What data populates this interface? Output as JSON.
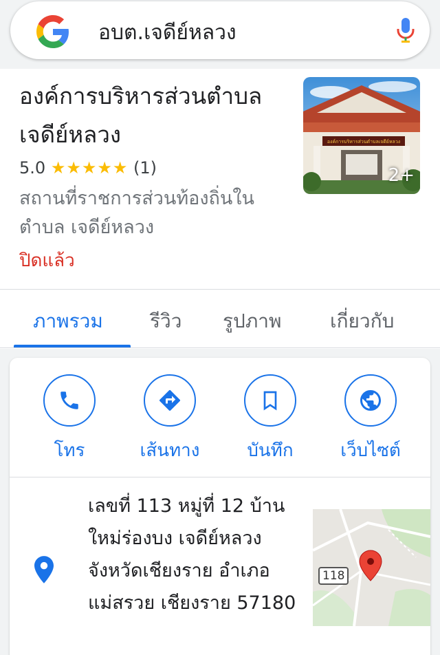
{
  "search": {
    "query": "อบต.เจดีย์หลวง"
  },
  "place": {
    "title": "องค์การบริหารส่วนตำบลเจดีย์หลวง",
    "rating_value": "5.0",
    "stars": "★★★★★",
    "review_count": "(1)",
    "category": "สถานที่ราชการส่วนท้องถิ่นในตำบล เจดีย์หลวง",
    "status": "ปิดแล้ว",
    "photo_count": "2+",
    "sign_text": "องค์การบริหารส่วนตำบลเจดีย์หลวง"
  },
  "tabs": [
    {
      "label": "ภาพรวม",
      "active": true
    },
    {
      "label": "รีวิว",
      "active": false
    },
    {
      "label": "รูปภาพ",
      "active": false
    },
    {
      "label": "เกี่ยวกับ",
      "active": false
    }
  ],
  "actions": [
    {
      "label": "โทร",
      "icon": "phone-icon"
    },
    {
      "label": "เส้นทาง",
      "icon": "directions-icon"
    },
    {
      "label": "บันทึก",
      "icon": "bookmark-icon"
    },
    {
      "label": "เว็บไซต์",
      "icon": "globe-icon"
    }
  ],
  "address": {
    "text": "เลขที่ 113 หมู่ที่ 12 บ้านใหม่ร่องบง เจดีย์หลวง จังหวัดเชียงราย อำเภอแม่สรวย เชียงราย 57180"
  },
  "map": {
    "road_number": "118"
  },
  "colors": {
    "accent": "#1a73e8",
    "closed": "#d93025",
    "star": "#fbbc04",
    "map_pin": "#ea4335"
  }
}
